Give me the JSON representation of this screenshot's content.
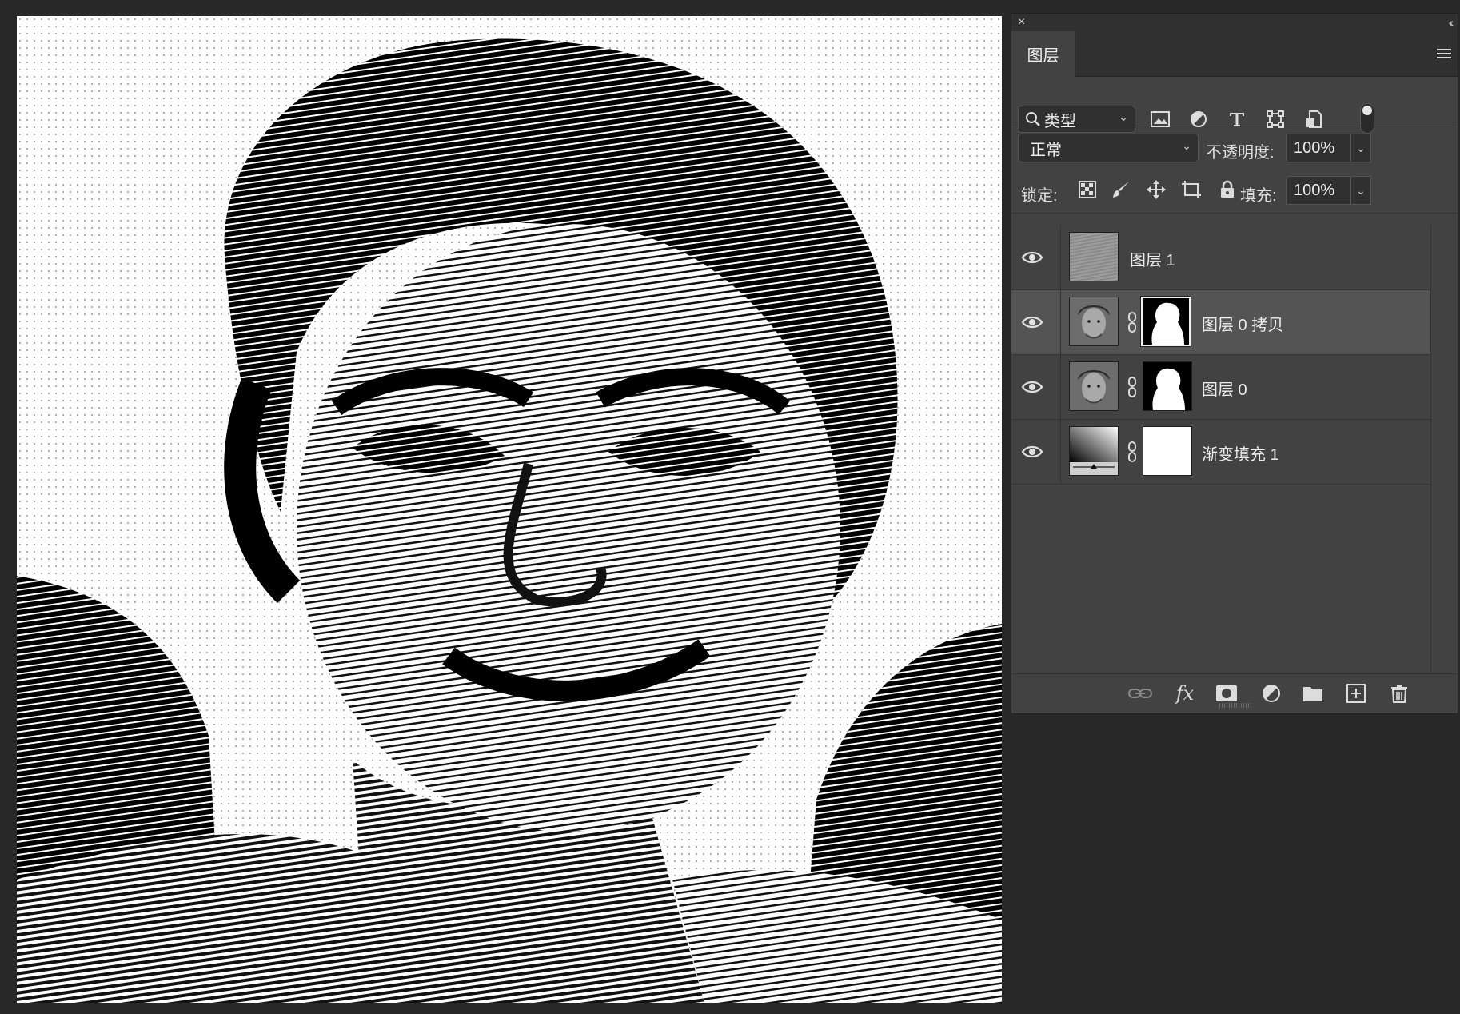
{
  "panel": {
    "close_icon": "×",
    "collapse_icon": "‹‹",
    "tab_label": "图层",
    "filter": {
      "kind_label": "类型",
      "icons": [
        "image-filter-icon",
        "adjustment-filter-icon",
        "type-filter-icon",
        "shape-filter-icon",
        "smart-object-filter-icon"
      ]
    },
    "blend_mode": "正常",
    "opacity_label": "不透明度:",
    "opacity_value": "100%",
    "lock_label": "锁定:",
    "fill_label": "填充:",
    "fill_value": "100%"
  },
  "layers": [
    {
      "name": "图层 1",
      "visible": true,
      "selected": false,
      "has_mask": false,
      "thumb": "gray-texture"
    },
    {
      "name": "图层 0 拷贝",
      "visible": true,
      "selected": true,
      "has_mask": true,
      "thumb": "portrait"
    },
    {
      "name": "图层 0",
      "visible": true,
      "selected": false,
      "has_mask": true,
      "thumb": "portrait"
    },
    {
      "name": "渐变填充 1",
      "visible": true,
      "selected": false,
      "has_mask": true,
      "thumb": "gradient"
    }
  ],
  "bottom_bar": {
    "icons": [
      "link-layers-icon",
      "fx-icon",
      "add-mask-icon",
      "adjustment-layer-icon",
      "new-group-icon",
      "new-layer-icon",
      "delete-layer-icon"
    ],
    "fx_label": "fx"
  },
  "colors": {
    "panel_bg": "#424242",
    "selected_row": "#545454",
    "app_bg": "#282828"
  }
}
